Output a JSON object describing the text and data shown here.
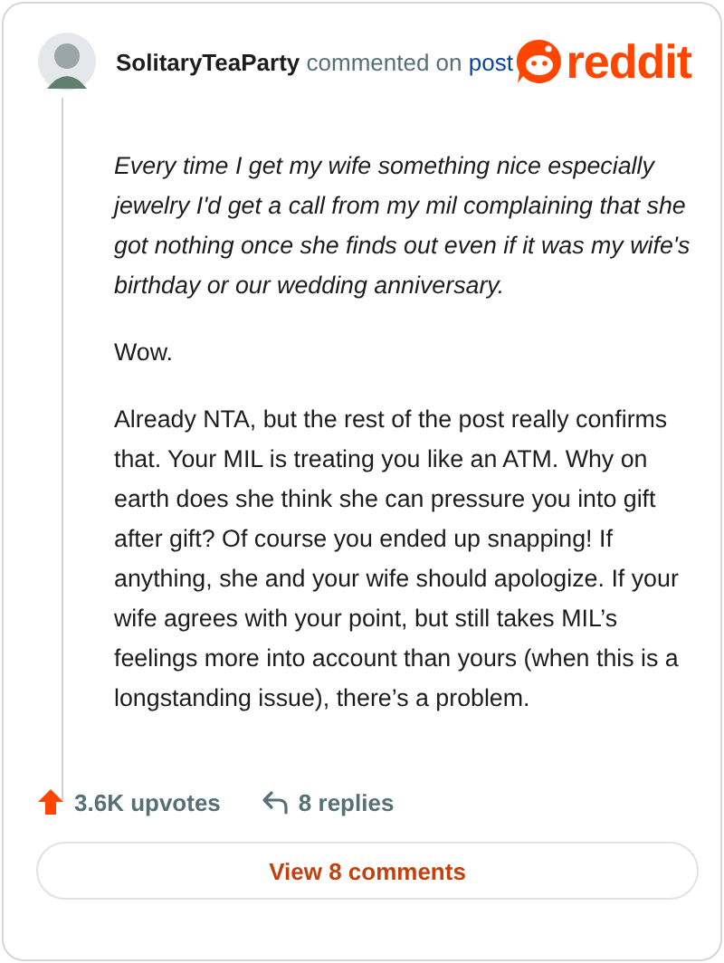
{
  "header": {
    "username": "SolitaryTeaParty",
    "action": "commented on",
    "link": "post",
    "logo": "reddit"
  },
  "paragraphs": [
    {
      "kind": "quote",
      "text": "Every time I get my wife something nice especially jewelry I'd get a call from my mil complaining that she got nothing once she finds out even if it was my wife's birthday or our wedding anniversary."
    },
    {
      "kind": "text",
      "text": "Wow."
    },
    {
      "kind": "text",
      "text": "Already NTA, but the rest of the post really confirms that. Your MIL is treating you like an ATM. Why on earth does she think she can pressure you into gift after gift? Of course you ended up snapping! If anything, she and your wife should apologize. If your wife agrees with your point, but still takes MIL’s feelings more into account than yours (when this is a longstanding issue), there’s a problem."
    }
  ],
  "footer": {
    "upvotes": "3.6K upvotes",
    "replies": "8 replies",
    "button": "View 8 comments"
  }
}
